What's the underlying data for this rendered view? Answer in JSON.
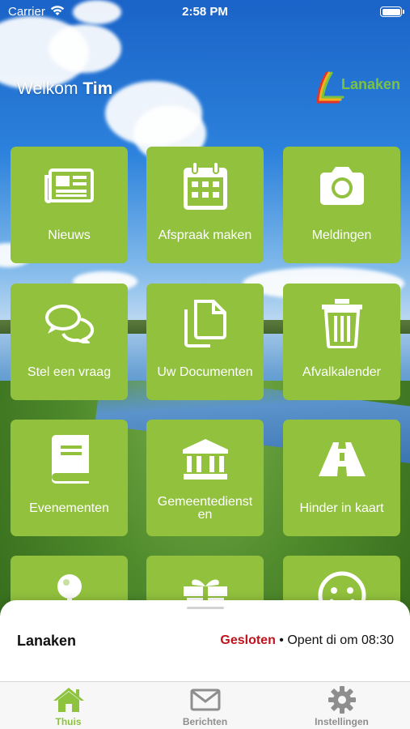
{
  "status_bar": {
    "carrier": "Carrier",
    "time": "2:58 PM",
    "wifi_icon": "wifi-icon",
    "battery_icon": "battery-icon"
  },
  "header": {
    "greeting": "Welkom",
    "user_name": "Tim",
    "logo_text": "Lanaken"
  },
  "tiles": [
    {
      "label": "Nieuws",
      "icon": "newspaper-icon"
    },
    {
      "label": "Afspraak maken",
      "icon": "calendar-icon"
    },
    {
      "label": "Meldingen",
      "icon": "camera-icon"
    },
    {
      "label": "Stel een vraag",
      "icon": "chat-bubbles-icon"
    },
    {
      "label": "Uw Documenten",
      "icon": "documents-icon"
    },
    {
      "label": "Afvalkalender",
      "icon": "trash-icon"
    },
    {
      "label": "Evenementen",
      "icon": "book-icon"
    },
    {
      "label": "Gemeentedienst en",
      "icon": "government-building-icon"
    },
    {
      "label": "Hinder in kaart",
      "icon": "road-icon"
    },
    {
      "label": "",
      "icon": "map-pin-icon"
    },
    {
      "label": "",
      "icon": "gift-icon"
    },
    {
      "label": "",
      "icon": "smiley-icon"
    }
  ],
  "info_sheet": {
    "name": "Lanaken",
    "status": "Gesloten",
    "separator": " • ",
    "opening": "Opent di om 08:30"
  },
  "tab_bar": {
    "items": [
      {
        "label": "Thuis",
        "icon": "home-icon",
        "active": true
      },
      {
        "label": "Berichten",
        "icon": "envelope-icon",
        "active": false
      },
      {
        "label": "Instellingen",
        "icon": "gear-icon",
        "active": false
      }
    ]
  },
  "colors": {
    "tile": "#91c13d",
    "active_tab": "#8dc33f",
    "inactive_tab": "#8e8e8e",
    "closed": "#c0121b"
  }
}
